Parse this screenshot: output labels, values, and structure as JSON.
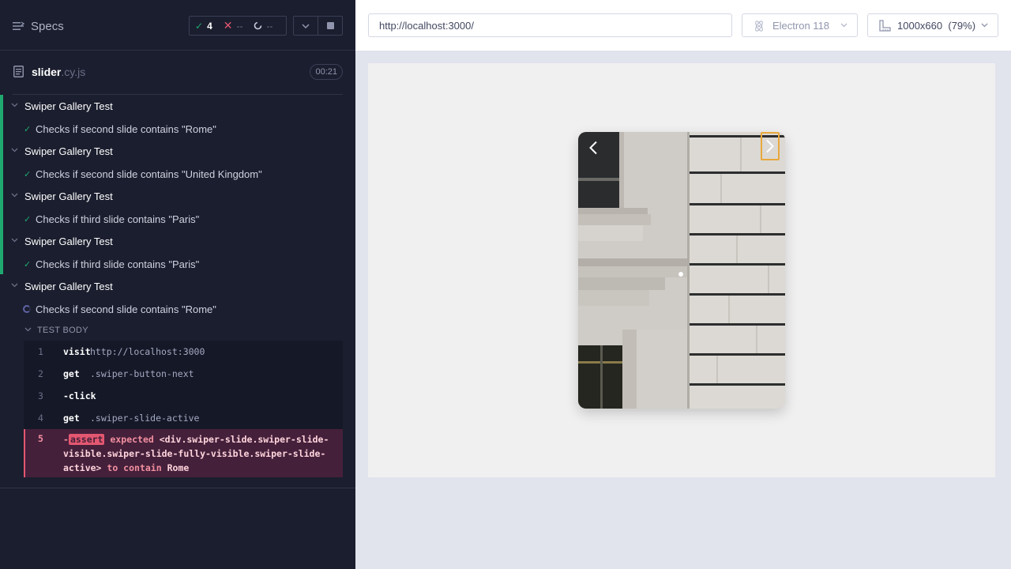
{
  "reporter": {
    "specs_label": "Specs",
    "stats": {
      "passed": "4",
      "failed": "--",
      "pending": "--"
    },
    "spec_file": {
      "name": "slider",
      "ext": ".cy.js",
      "duration": "00:21"
    },
    "suites": [
      {
        "title": "Swiper Gallery Test",
        "test": "Checks if second slide contains \"Rome\"",
        "state": "passed"
      },
      {
        "title": "Swiper Gallery Test",
        "test": "Checks if second slide contains \"United Kingdom\"",
        "state": "passed"
      },
      {
        "title": "Swiper Gallery Test",
        "test": "Checks if third slide contains \"Paris\"",
        "state": "passed"
      },
      {
        "title": "Swiper Gallery Test",
        "test": "Checks if third slide contains \"Paris\"",
        "state": "passed"
      },
      {
        "title": "Swiper Gallery Test",
        "test": "Checks if second slide contains \"Rome\"",
        "state": "running"
      }
    ],
    "test_body_label": "TEST BODY",
    "commands": [
      {
        "num": "1",
        "name": "visit",
        "message": "http://localhost:3000"
      },
      {
        "num": "2",
        "name": "get",
        "message": ".swiper-button-next"
      },
      {
        "num": "3",
        "name": "-click",
        "message": ""
      },
      {
        "num": "4",
        "name": "get",
        "message": ".swiper-slide-active"
      }
    ],
    "failed_command": {
      "num": "5",
      "prefix": "-",
      "badge": "assert",
      "expected": "expected",
      "subject": "<div.swiper-slide.swiper-slide-visible.swiper-slide-fully-visible.swiper-slide-active>",
      "to_contain": "to contain",
      "value": "Rome"
    }
  },
  "aut": {
    "url": "http://localhost:3000/",
    "browser": "Electron 118",
    "viewport": "1000x660",
    "zoom": "(79%)"
  },
  "colors": {
    "passed": "#1fa971",
    "failed": "#e45770",
    "reporter_bg": "#1b1e2e",
    "next_button_highlight": "#e8a83c"
  }
}
